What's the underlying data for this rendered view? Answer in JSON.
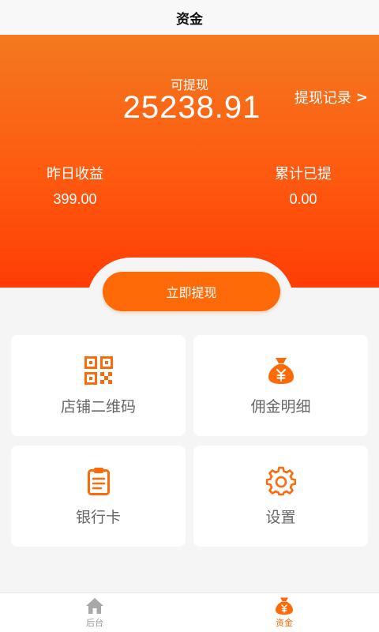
{
  "header": {
    "title": "资金"
  },
  "balance": {
    "label": "可提现",
    "amount": "25238.91",
    "records_link": "提现记录",
    "records_chevron": ">"
  },
  "stats": {
    "yesterday": {
      "label": "昨日收益",
      "value": "399.00"
    },
    "total_withdrawn": {
      "label": "累计已提",
      "value": "0.00"
    }
  },
  "withdraw_button": {
    "label": "立即提现"
  },
  "menu": [
    {
      "label": "店铺二维码",
      "icon": "qr-code-icon"
    },
    {
      "label": "佣金明细",
      "icon": "money-bag-icon"
    },
    {
      "label": "银行卡",
      "icon": "clipboard-icon"
    },
    {
      "label": "设置",
      "icon": "gear-icon"
    }
  ],
  "tabbar": [
    {
      "label": "后台",
      "icon": "home-icon",
      "active": false
    },
    {
      "label": "资金",
      "icon": "money-bag-icon",
      "active": true
    }
  ],
  "colors": {
    "accent": "#fe6a07",
    "hero_top": "#f3791f",
    "hero_bottom": "#ff3d05",
    "background": "#f5f5f5",
    "inactive_tab": "#9a9a9a"
  }
}
